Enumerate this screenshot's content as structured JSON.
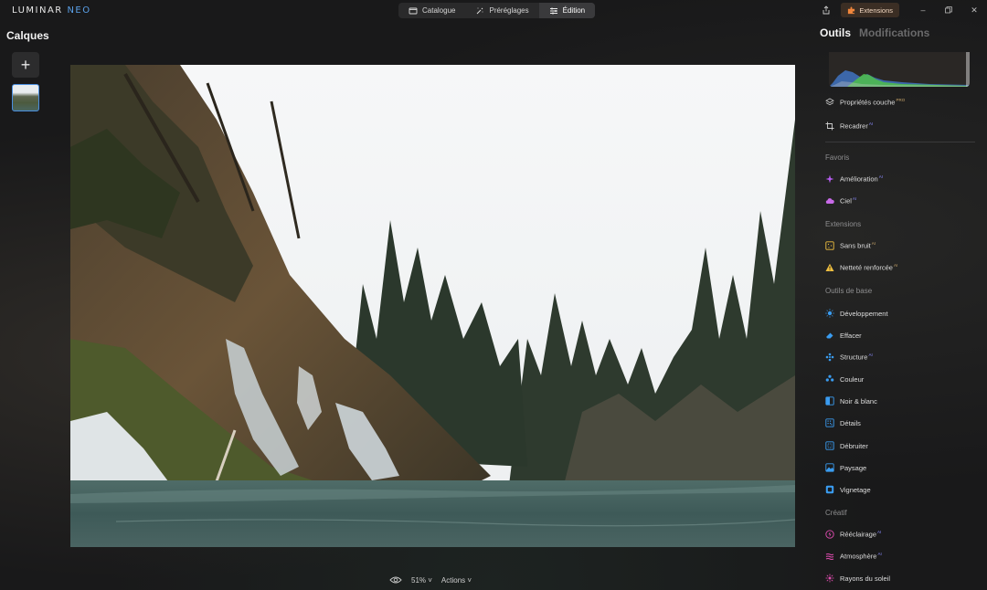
{
  "app": {
    "logo_main": "LUMINAR",
    "logo_neo": "NEO"
  },
  "modes": [
    {
      "label": "Catalogue",
      "icon": "folder-icon",
      "active": false
    },
    {
      "label": "Préréglages",
      "icon": "magic-wand-icon",
      "active": false
    },
    {
      "label": "Édition",
      "icon": "sliders-icon",
      "active": true
    }
  ],
  "topbar": {
    "extensions_label": "Extensions",
    "accent": "#f0863c"
  },
  "left_panel": {
    "title": "Calques",
    "add_symbol": "+"
  },
  "bottombar": {
    "zoom": "51%",
    "actions_label": "Actions"
  },
  "right_panel": {
    "tab_tools": "Outils",
    "tab_edits": "Modifications",
    "top_tools": [
      {
        "label": "Propriétés couche",
        "badge": "PRO",
        "icon": "layers-icon"
      },
      {
        "label": "Recadrer",
        "badge": "AI",
        "icon": "crop-icon"
      }
    ],
    "sections": [
      {
        "title": "Favoris",
        "tools": [
          {
            "label": "Amélioration",
            "badge": "AI",
            "icon": "sparkle-icon",
            "color": "#b65cf0"
          },
          {
            "label": "Ciel",
            "badge": "AI",
            "icon": "cloud-icon",
            "color": "#c86ae8"
          }
        ]
      },
      {
        "title": "Extensions",
        "tools": [
          {
            "label": "Sans bruit",
            "badge": "AI",
            "icon": "noise-icon",
            "color": "#f0c040"
          },
          {
            "label": "Netteté renforcée",
            "badge": "AI",
            "icon": "warning-triangle-icon",
            "color": "#f0c040"
          }
        ]
      },
      {
        "title": "Outils de base",
        "tools": [
          {
            "label": "Développement",
            "badge": "",
            "icon": "sun-icon",
            "color": "#3a9cf0"
          },
          {
            "label": "Effacer",
            "badge": "",
            "icon": "eraser-icon",
            "color": "#3a9cf0"
          },
          {
            "label": "Structure",
            "badge": "AI",
            "icon": "structure-icon",
            "color": "#3a9cf0"
          },
          {
            "label": "Couleur",
            "badge": "",
            "icon": "color-icon",
            "color": "#3a9cf0"
          },
          {
            "label": "Noir & blanc",
            "badge": "",
            "icon": "bw-icon",
            "color": "#3a9cf0"
          },
          {
            "label": "Détails",
            "badge": "",
            "icon": "details-icon",
            "color": "#3a9cf0"
          },
          {
            "label": "Débruiter",
            "badge": "",
            "icon": "denoise-icon",
            "color": "#3a9cf0"
          },
          {
            "label": "Paysage",
            "badge": "",
            "icon": "landscape-icon",
            "color": "#3a9cf0"
          },
          {
            "label": "Vignetage",
            "badge": "",
            "icon": "vignette-icon",
            "color": "#3a9cf0"
          }
        ]
      },
      {
        "title": "Créatif",
        "tools": [
          {
            "label": "Rééclairage",
            "badge": "AI",
            "icon": "relight-icon",
            "color": "#e04cb0"
          },
          {
            "label": "Atmosphère",
            "badge": "AI",
            "icon": "atmosphere-icon",
            "color": "#e04cb0"
          },
          {
            "label": "Rayons du soleil",
            "badge": "",
            "icon": "sunrays-icon",
            "color": "#e04cb0"
          }
        ]
      }
    ]
  }
}
